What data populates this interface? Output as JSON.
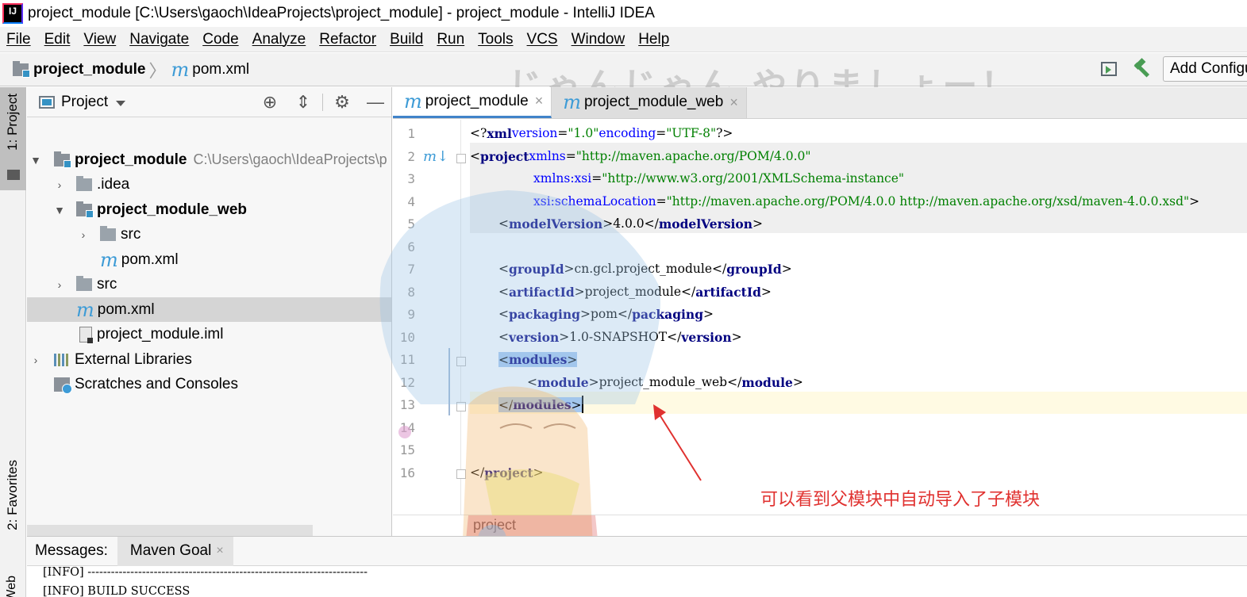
{
  "window": {
    "title": "project_module [C:\\Users\\gaoch\\IdeaProjects\\project_module] - project_module - IntelliJ IDEA",
    "app_icon_text": "IJ"
  },
  "menu": [
    "File",
    "Edit",
    "View",
    "Navigate",
    "Code",
    "Analyze",
    "Refactor",
    "Build",
    "Run",
    "Tools",
    "VCS",
    "Window",
    "Help"
  ],
  "navbar": {
    "project": "project_module",
    "file": "pom.xml",
    "add_config": "Add Configuration..."
  },
  "watermark": "じゃんじゃん やりましょー！",
  "left_stripe": {
    "project": "1: Project",
    "favorites": "2: Favorites",
    "web": "Web"
  },
  "project_panel": {
    "title": "Project",
    "tree": [
      {
        "label": "project_module",
        "path": "C:\\Users\\gaoch\\IdeaProjects\\p",
        "bold": true,
        "expanded": true,
        "icon": "module-folder-icon"
      },
      {
        "label": ".idea",
        "icon": "folder-icon",
        "expanded": false
      },
      {
        "label": "project_module_web",
        "bold": true,
        "expanded": true,
        "icon": "module-folder-icon"
      },
      {
        "label": "src",
        "icon": "folder-icon",
        "expanded": false
      },
      {
        "label": "pom.xml",
        "icon": "maven-icon"
      },
      {
        "label": "src",
        "icon": "folder-icon",
        "expanded": false
      },
      {
        "label": "pom.xml",
        "icon": "maven-icon",
        "selected": true
      },
      {
        "label": "project_module.iml",
        "icon": "iml-file-icon"
      },
      {
        "label": "External Libraries",
        "icon": "libraries-icon",
        "expanded": false
      },
      {
        "label": "Scratches and Consoles",
        "icon": "scratches-icon"
      }
    ]
  },
  "editor": {
    "tabs": [
      {
        "label": "project_module",
        "active": true
      },
      {
        "label": "project_module_web",
        "active": false
      }
    ],
    "line_numbers": [
      "1",
      "2",
      "3",
      "4",
      "5",
      "6",
      "7",
      "8",
      "9",
      "10",
      "11",
      "12",
      "13",
      "14",
      "15",
      "16"
    ],
    "breadcrumb": "project",
    "code": {
      "l1_decl": "<?",
      "l1_xml": "xml",
      "l1_version_attr": "version",
      "l1_version_val": "\"1.0\"",
      "l1_encoding_attr": "encoding",
      "l1_encoding_val": "\"UTF-8\"",
      "l1_end": "?>",
      "project_tag": "project",
      "xmlns_attr": "xmlns",
      "xmlns_val": "\"http://maven.apache.org/POM/4.0.0\"",
      "xsi_attr": "xmlns:xsi",
      "xsi_val": "\"http://www.w3.org/2001/XMLSchema-instance\"",
      "schema_attr": "xsi:schemaLocation",
      "schema_val": "\"http://maven.apache.org/POM/4.0.0 http://maven.apache.org/xsd/maven-4.0.0.xsd\"",
      "model_tag": "modelVersion",
      "model_val": "4.0.0",
      "group_tag": "groupId",
      "group_val": "cn.gcl.project_module",
      "artifact_tag": "artifactId",
      "artifact_val": "project_module",
      "packaging_tag": "packaging",
      "packaging_val": "pom",
      "version_tag": "version",
      "version_val": "1.0-SNAPSHOT",
      "modules_tag": "modules",
      "module_tag": "module",
      "module_val": "project_module_web"
    }
  },
  "annotation": "可以看到父模块中自动导入了子模块",
  "messages": {
    "title": "Messages:",
    "tab": "Maven Goal",
    "lines": [
      "[INFO] ------------------------------------------------------------------------",
      "[INFO] BUILD SUCCESS"
    ]
  }
}
